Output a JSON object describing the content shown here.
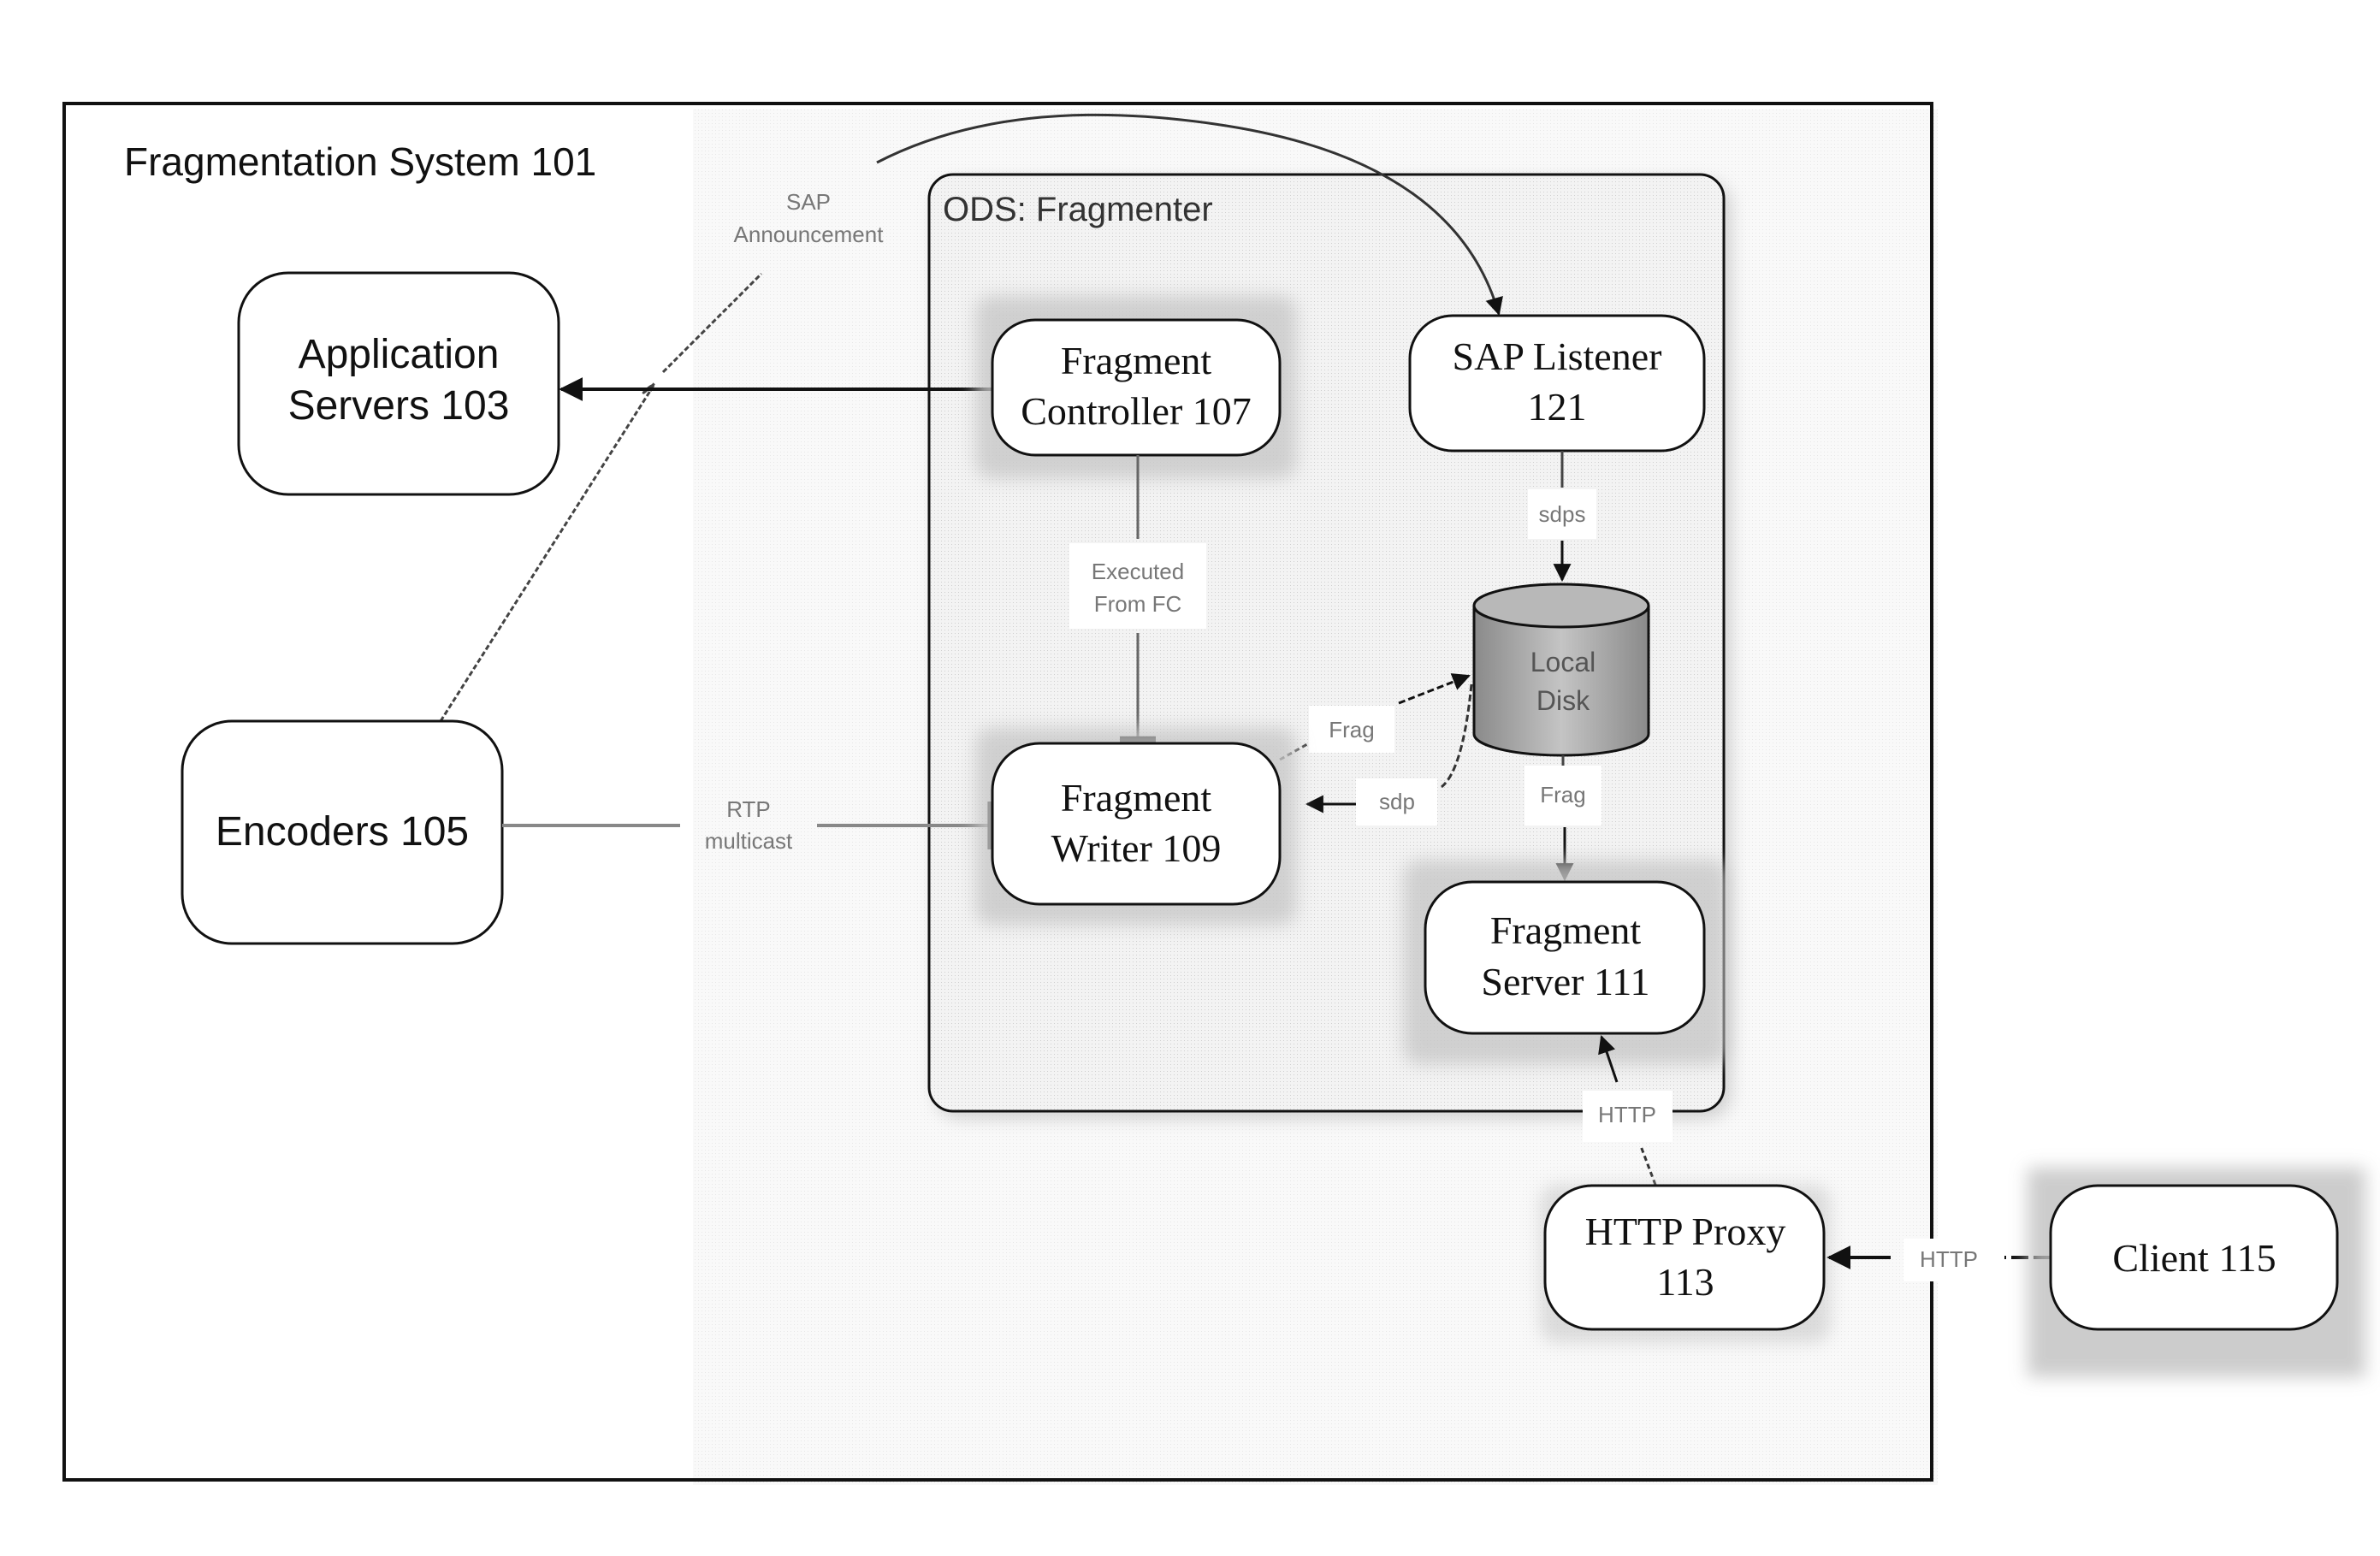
{
  "system": {
    "title": "Fragmentation System 101"
  },
  "container": {
    "title": "ODS: Fragmenter"
  },
  "nodes": {
    "application_servers": {
      "line1": "Application",
      "line2": "Servers 103"
    },
    "encoders": {
      "line1": "Encoders 105"
    },
    "fragment_controller": {
      "line1": "Fragment",
      "line2": "Controller 107"
    },
    "sap_listener": {
      "line1": "SAP Listener",
      "line2": "121"
    },
    "local_disk": {
      "line1": "Local",
      "line2": "Disk"
    },
    "fragment_writer": {
      "line1": "Fragment",
      "line2": "Writer 109"
    },
    "fragment_server": {
      "line1": "Fragment",
      "line2": "Server 111"
    },
    "http_proxy": {
      "line1": "HTTP Proxy",
      "line2": "113"
    },
    "client": {
      "line1": "Client 115"
    }
  },
  "edges": {
    "sap_announcement": {
      "line1": "SAP",
      "line2": "Announcement"
    },
    "rtp_multicast": {
      "line1": "RTP",
      "line2": "multicast"
    },
    "executed_from_fc": {
      "line1": "Executed",
      "line2": "From FC"
    },
    "sdps": {
      "label": "sdps"
    },
    "frag_writer_to_disk": {
      "label": "Frag"
    },
    "sdp_disk_to_writer": {
      "label": "sdp"
    },
    "frag_disk_to_server": {
      "label": "Frag"
    },
    "http_proxy_to_server": {
      "label": "HTTP"
    },
    "http_client_to_proxy": {
      "label": "HTTP"
    }
  },
  "colors": {
    "line": "#111111",
    "label_gray": "#777777",
    "container_fill": "#ececec",
    "disk_fill": "#a8a8a8"
  }
}
